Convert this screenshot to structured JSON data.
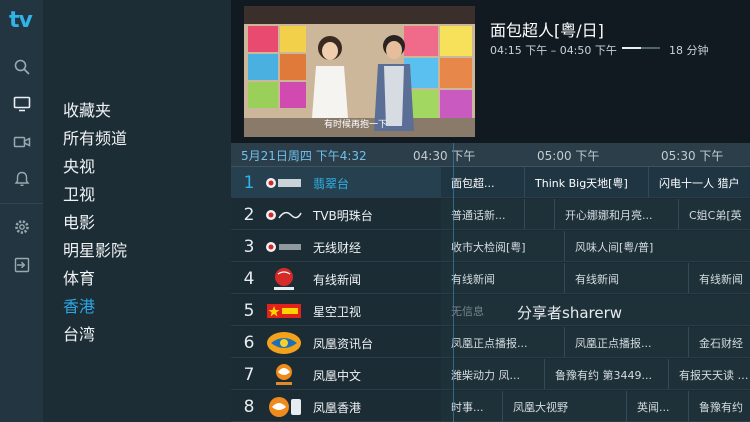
{
  "app": {
    "logo": "tv"
  },
  "rail": {
    "icons": [
      "search-icon",
      "tv-icon",
      "video-camera-icon",
      "bell-icon",
      "gear-icon",
      "exit-icon"
    ]
  },
  "menu": {
    "items": [
      "收藏夹",
      "所有频道",
      "央视",
      "卫视",
      "电影",
      "明星影院",
      "体育",
      "香港",
      "台湾"
    ],
    "active": "香港"
  },
  "now_playing": {
    "title": "面包超人[粤/日]",
    "time_range": "04:15 下午 – 04:50 下午",
    "progress_fraction": 0.5,
    "duration": "18 分钟",
    "video_caption": "有时候再抱一下"
  },
  "timeline": {
    "date": "5月21日周四 下午4:32",
    "slots": [
      "04:30 下午",
      "05:00 下午",
      "05:30 下午"
    ]
  },
  "channels": [
    {
      "num": "1",
      "name": "翡翠台",
      "logo": "TVB翡翠台",
      "programs": [
        "面包超...",
        "Think Big天地[粤]",
        "闪电十一人 猎户"
      ]
    },
    {
      "num": "2",
      "name": "TVB明珠台",
      "logo": "Pearl",
      "programs": [
        "普通话新...",
        "",
        "开心娜娜和月亮...",
        "C姐C弟[英"
      ]
    },
    {
      "num": "3",
      "name": "无线财经",
      "logo": "TVB",
      "programs": [
        "收市大检阅[粤]",
        "风味人间[粤/普]"
      ]
    },
    {
      "num": "4",
      "name": "有线新闻",
      "logo": "HKC有线台",
      "programs": [
        "有线新闻",
        "有线新闻",
        "有线新闻"
      ]
    },
    {
      "num": "5",
      "name": "星空卫视",
      "logo": "星空",
      "programs": [
        "无信息"
      ]
    },
    {
      "num": "6",
      "name": "凤凰资讯台",
      "logo": "凤凰",
      "programs": [
        "凤凰正点播报...",
        "凤凰正点播报...",
        "金石财经"
      ]
    },
    {
      "num": "7",
      "name": "凤凰中文",
      "logo": "凤凰卫视",
      "programs": [
        "潍柴动力 凤...",
        "鲁豫有约 第3449...",
        "有报天天读 …"
      ]
    },
    {
      "num": "8",
      "name": "凤凰香港",
      "logo": "凤凰",
      "programs": [
        "时事...",
        "凤凰大视野",
        "英闻...",
        "鲁豫有约"
      ]
    }
  ],
  "watermark": "分享者sharerw",
  "colors": {
    "accent": "#2fb3e8",
    "background": "#1b2a33"
  }
}
